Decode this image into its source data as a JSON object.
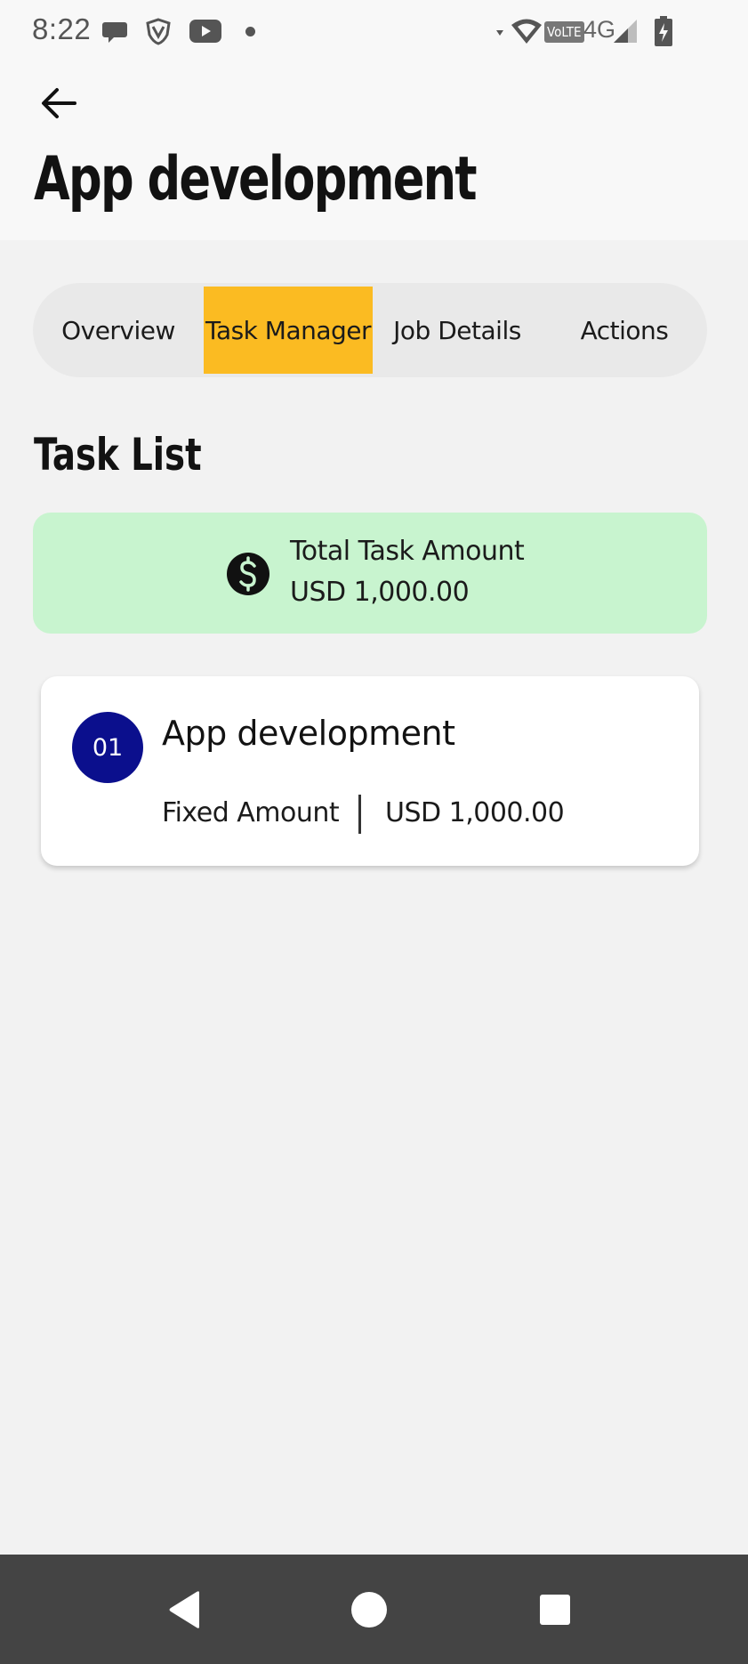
{
  "status_bar": {
    "time": "8:22",
    "network_badge": "VoLTE",
    "network_type": "4G",
    "icons": [
      "chat-bubble-icon",
      "shield-v-icon",
      "youtube-icon",
      "notification-dot-icon",
      "data-arrows-icon",
      "wifi-icon",
      "signal-icon",
      "battery-charging-icon"
    ]
  },
  "header": {
    "back_icon": "arrow-left-icon",
    "title": "App development"
  },
  "tabs": [
    {
      "label": "Overview",
      "active": false
    },
    {
      "label": "Task Manager",
      "active": true
    },
    {
      "label": "Job Details",
      "active": false
    },
    {
      "label": "Actions",
      "active": false
    }
  ],
  "task_list": {
    "title": "Task List",
    "total": {
      "icon": "dollar-circle-icon",
      "label": "Total Task Amount",
      "value": "USD 1,000.00"
    },
    "items": [
      {
        "number": "01",
        "name": "App development",
        "type": "Fixed Amount",
        "amount": "USD 1,000.00"
      }
    ]
  },
  "colors": {
    "active_tab": "#fbbb22",
    "total_box": "#c8f4cf",
    "badge": "#0b0f8d",
    "nav_bar": "#444444"
  },
  "nav_bar": {
    "buttons": [
      "back-triangle-icon",
      "home-circle-icon",
      "recents-square-icon"
    ]
  }
}
